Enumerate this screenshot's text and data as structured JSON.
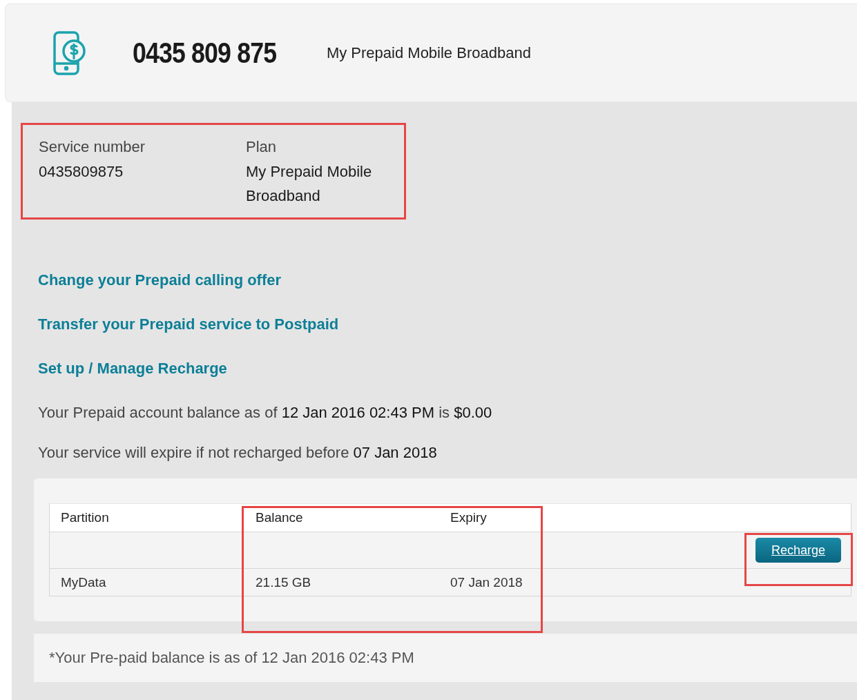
{
  "header": {
    "phone_number": "0435 809 875",
    "plan_name": "My Prepaid Mobile Broadband"
  },
  "service_info": [
    {
      "label": "Service number",
      "value": "0435809875"
    },
    {
      "label": "Plan",
      "value": "My Prepaid Mobile Broadband"
    }
  ],
  "links": [
    "Change your Prepaid calling offer",
    "Transfer your Prepaid service to Postpaid",
    "Set up / Manage Recharge"
  ],
  "balance_text": "Your Prepaid account balance as of **12 Jan 2016 02:43 PM** is **$0.00**",
  "expiry_text": "Your service will expire if not recharged before **07 Jan 2018**",
  "table": {
    "columns": [
      "Partition",
      "Balance",
      "Expiry"
    ],
    "button": "Recharge",
    "rows": [
      {
        "partition": "MyData",
        "balance": "21.15 GB",
        "expiry": "07 Jan 2018"
      }
    ]
  },
  "footnote": "*Your Pre-paid balance is as of 12 Jan 2016 02:43 PM"
}
